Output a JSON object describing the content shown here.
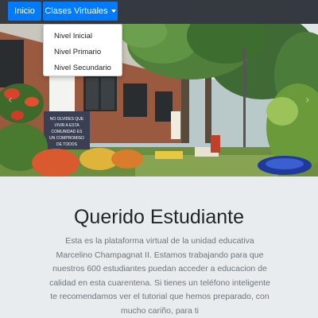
{
  "navbar": {
    "home_label": "Inicio",
    "classes_label": "Clases Virtuales"
  },
  "dropdown": {
    "items": [
      {
        "label": "Nivel Inicial"
      },
      {
        "label": "Nivel Primario"
      },
      {
        "label": "Nivel Secundario"
      }
    ]
  },
  "hero": {
    "sign_text": "NO OLVIDES QUE VIVIR A ESTA COMUNIDAD ES UN COMPROMISO DE TODOS"
  },
  "main": {
    "title": "Querido Estudiante",
    "lines": [
      "Esta es la plataforma virtual de la unidad educativa",
      "Marcelino Champagnat II. Estamos trabajando para que",
      "nuestros 600 estudiantes puedan acceder a educacion de",
      "calidad en esta cuarentena. Si tienes un teléfono inteligente",
      "te recomendamos ver el tutorial que hemos preparado, con",
      "mucho cariño, para ti"
    ]
  }
}
